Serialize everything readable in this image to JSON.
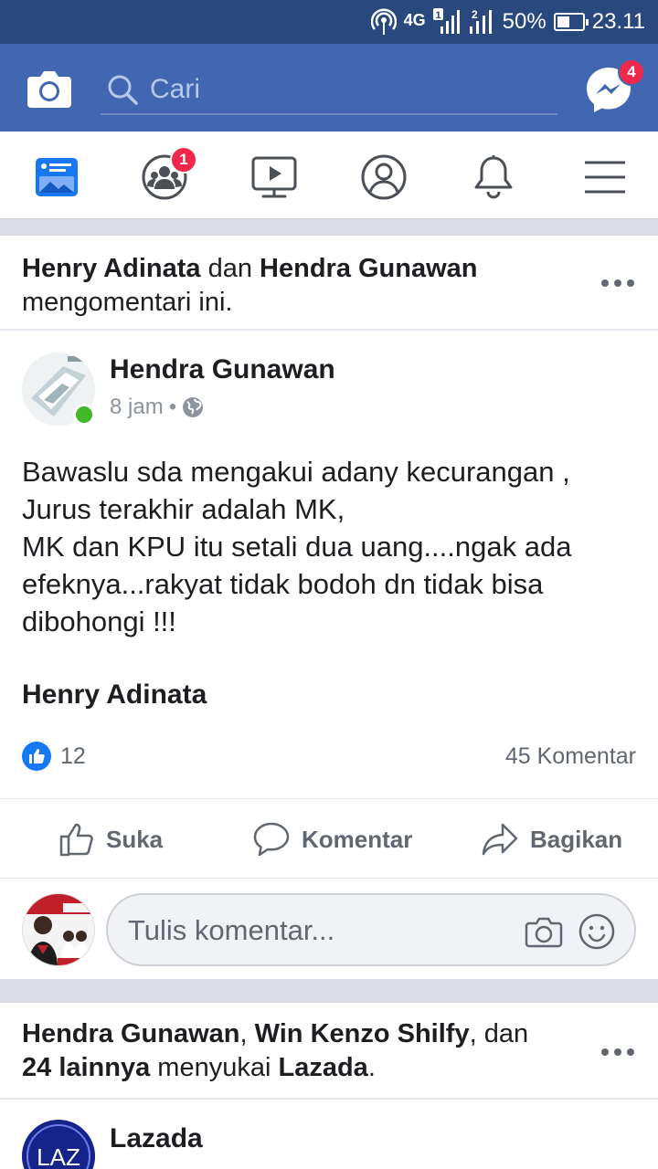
{
  "status_bar": {
    "network": "4G",
    "sim1": "1",
    "sim2": "2",
    "battery": "50%",
    "battery_level": 0.5,
    "time": "23.11"
  },
  "topbar": {
    "search_placeholder": "Cari",
    "messenger_badge": "4",
    "brand_color": "#4267b2"
  },
  "nav": {
    "items": [
      {
        "name": "news-feed-icon",
        "active": true
      },
      {
        "name": "friends-icon",
        "badge": "1"
      },
      {
        "name": "watch-icon"
      },
      {
        "name": "profile-icon"
      },
      {
        "name": "notifications-icon"
      },
      {
        "name": "menu-icon"
      }
    ]
  },
  "story1": {
    "actor1": "Henry Adinata",
    "conj": " dan ",
    "actor2": "Hendra Gunawan",
    "action": "mengomentari ini."
  },
  "post": {
    "author": "Hendra Gunawan",
    "time": "8 jam",
    "separator": "•",
    "text": "Bawaslu sda mengakui adany kecurangan ,\nJurus terakhir adalah MK,\nMK dan KPU itu setali dua uang....ngak ada efeknya...rakyat tidak bodoh dn tidak bisa dibohongi !!!",
    "signature": "Henry Adinata",
    "likes": "12",
    "comments": "45 Komentar",
    "actions": {
      "like": "Suka",
      "comment": "Komentar",
      "share": "Bagikan"
    },
    "comment_placeholder": "Tulis komentar..."
  },
  "story2": {
    "actor1": "Hendra Gunawan",
    "sep1": ", ",
    "actor2": "Win Kenzo Shilfy",
    "sep2": ", dan ",
    "others": "24 lainnya",
    "action": " menyukai ",
    "page": "Lazada",
    "end": "."
  },
  "post2": {
    "author": "Lazada",
    "avatar_text": "LAZ"
  }
}
